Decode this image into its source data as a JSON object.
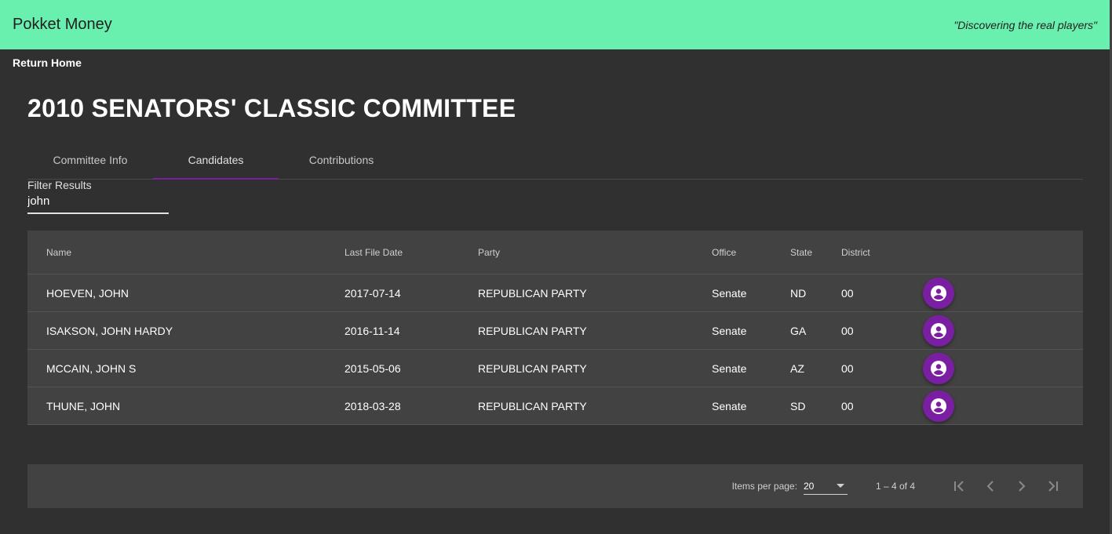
{
  "app": {
    "title": "Pokket Money",
    "tagline": "\"Discovering the real players\""
  },
  "nav": {
    "return_home": "Return Home"
  },
  "page": {
    "title": "2010 SENATORS' CLASSIC COMMITTEE"
  },
  "tabs": [
    {
      "label": "Committee Info",
      "active": false
    },
    {
      "label": "Candidates",
      "active": true
    },
    {
      "label": "Contributions",
      "active": false
    }
  ],
  "filter": {
    "label": "Filter Results",
    "value": "john"
  },
  "table": {
    "headers": [
      "Name",
      "Last File Date",
      "Party",
      "Office",
      "State",
      "District"
    ],
    "rows": [
      {
        "name": "HOEVEN, JOHN",
        "date": "2017-07-14",
        "party": "REPUBLICAN PARTY",
        "office": "Senate",
        "state": "ND",
        "district": "00",
        "action_icon": "account-circle-icon"
      },
      {
        "name": "ISAKSON, JOHN HARDY",
        "date": "2016-11-14",
        "party": "REPUBLICAN PARTY",
        "office": "Senate",
        "state": "GA",
        "district": "00",
        "action_icon": "account-circle-icon"
      },
      {
        "name": "MCCAIN, JOHN S",
        "date": "2015-05-06",
        "party": "REPUBLICAN PARTY",
        "office": "Senate",
        "state": "AZ",
        "district": "00",
        "action_icon": "account-circle-icon"
      },
      {
        "name": "THUNE, JOHN",
        "date": "2018-03-28",
        "party": "REPUBLICAN PARTY",
        "office": "Senate",
        "state": "SD",
        "district": "00",
        "action_icon": "account-circle-icon"
      }
    ]
  },
  "paginator": {
    "items_per_page_label": "Items per page:",
    "items_per_page": "20",
    "range": "1 – 4 of 4",
    "icons": [
      "first-page-icon",
      "prev-page-icon",
      "next-page-icon",
      "last-page-icon"
    ]
  },
  "colors": {
    "toolbar": "#69f0ae",
    "background": "#303030",
    "surface": "#424242",
    "accent": "#7b1fa2"
  }
}
